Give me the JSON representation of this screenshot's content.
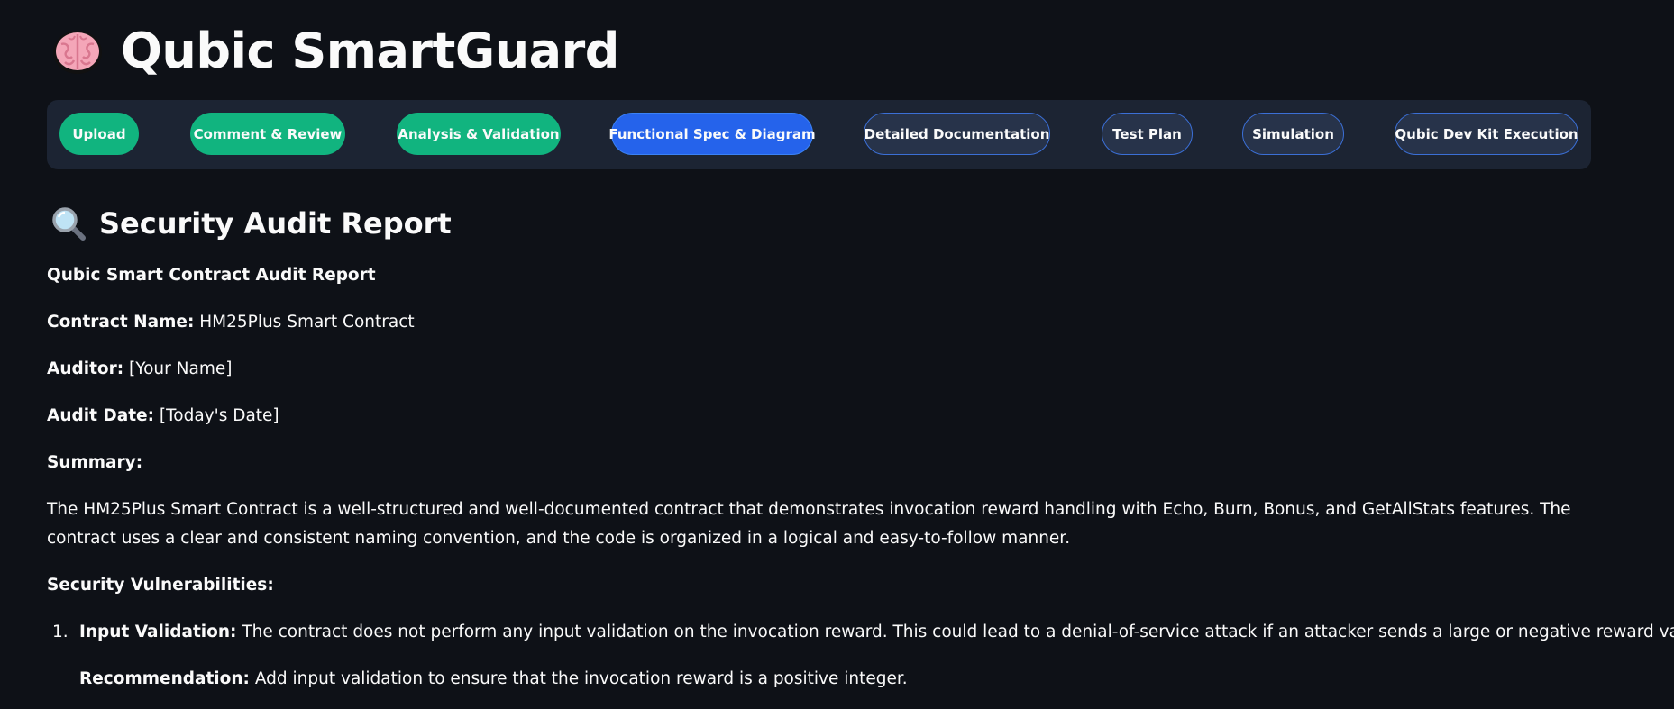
{
  "app": {
    "title": "Qubic SmartGuard",
    "logo_icon": "brain-icon"
  },
  "nav": {
    "steps": [
      {
        "label": "Upload",
        "state": "done"
      },
      {
        "label": "Comment & Review",
        "state": "done"
      },
      {
        "label": "Analysis & Validation",
        "state": "done"
      },
      {
        "label": "Functional Spec & Diagram",
        "state": "active"
      },
      {
        "label": "Detailed Documentation",
        "state": "pending"
      },
      {
        "label": "Test Plan",
        "state": "pending"
      },
      {
        "label": "Simulation",
        "state": "pending"
      },
      {
        "label": "Qubic Dev Kit Execution",
        "state": "pending"
      }
    ]
  },
  "report": {
    "section_title": "Security Audit Report",
    "section_icon": "magnifier-icon",
    "heading": "Qubic Smart Contract Audit Report",
    "contract_name_label": "Contract Name:",
    "contract_name_value": "HM25Plus Smart Contract",
    "auditor_label": "Auditor:",
    "auditor_value": "[Your Name]",
    "audit_date_label": "Audit Date:",
    "audit_date_value": "[Today's Date]",
    "summary_label": "Summary:",
    "summary_text": "The HM25Plus Smart Contract is a well-structured and well-documented contract that demonstrates invocation reward handling with Echo, Burn, Bonus, and GetAllStats features. The contract uses a clear and consistent naming convention, and the code is organized in a logical and easy-to-follow manner.",
    "vulnerabilities_label": "Security Vulnerabilities:",
    "vulnerabilities": [
      {
        "number": "1.",
        "title": "Input Validation:",
        "text": "The contract does not perform any input validation on the invocation reward. This could lead to a denial-of-service attack if an attacker sends a large or negative reward value.",
        "recommendation_label": "Recommendation:",
        "recommendation_text": "Add input validation to ensure that the invocation reward is a positive integer."
      }
    ]
  },
  "colors": {
    "background": "#0e1117",
    "nav_background": "#1c2433",
    "done": "#11b47f",
    "active": "#2563eb",
    "pending": "#27334a"
  }
}
